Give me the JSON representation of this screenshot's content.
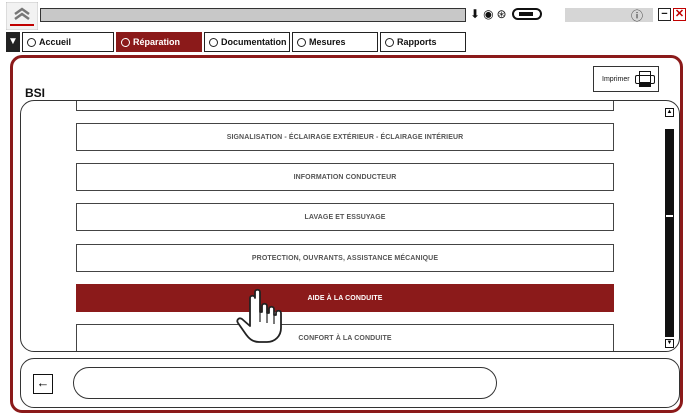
{
  "header": {
    "title_value": "",
    "status_icons": [
      "download-icon",
      "user-icon",
      "settings-icon",
      "battery-icon"
    ],
    "right_icon": "info-icon"
  },
  "tabs": [
    {
      "label": "Accueil",
      "active": false
    },
    {
      "label": "Réparation",
      "active": true
    },
    {
      "label": "Documentation",
      "active": false
    },
    {
      "label": "Mesures",
      "active": false
    },
    {
      "label": "Rapports",
      "active": false
    }
  ],
  "panel": {
    "title": "BSI",
    "print_label": "Imprimer"
  },
  "list": {
    "items": [
      {
        "label": "SIGNALISATION - ÉCLAIRAGE EXTÉRIEUR - ÉCLAIRAGE INTÉRIEUR",
        "selected": false
      },
      {
        "label": "INFORMATION CONDUCTEUR",
        "selected": false
      },
      {
        "label": "LAVAGE ET ESSUYAGE",
        "selected": false
      },
      {
        "label": "PROTECTION, OUVRANTS, ASSISTANCE MÉCANIQUE",
        "selected": false
      },
      {
        "label": "AIDE À LA CONDUITE",
        "selected": true
      },
      {
        "label": "CONFORT À LA CONDUITE",
        "selected": false
      }
    ]
  },
  "footer": {
    "back_icon": "arrow-left-icon",
    "path_value": ""
  },
  "colors": {
    "accent": "#8b1a1a"
  }
}
